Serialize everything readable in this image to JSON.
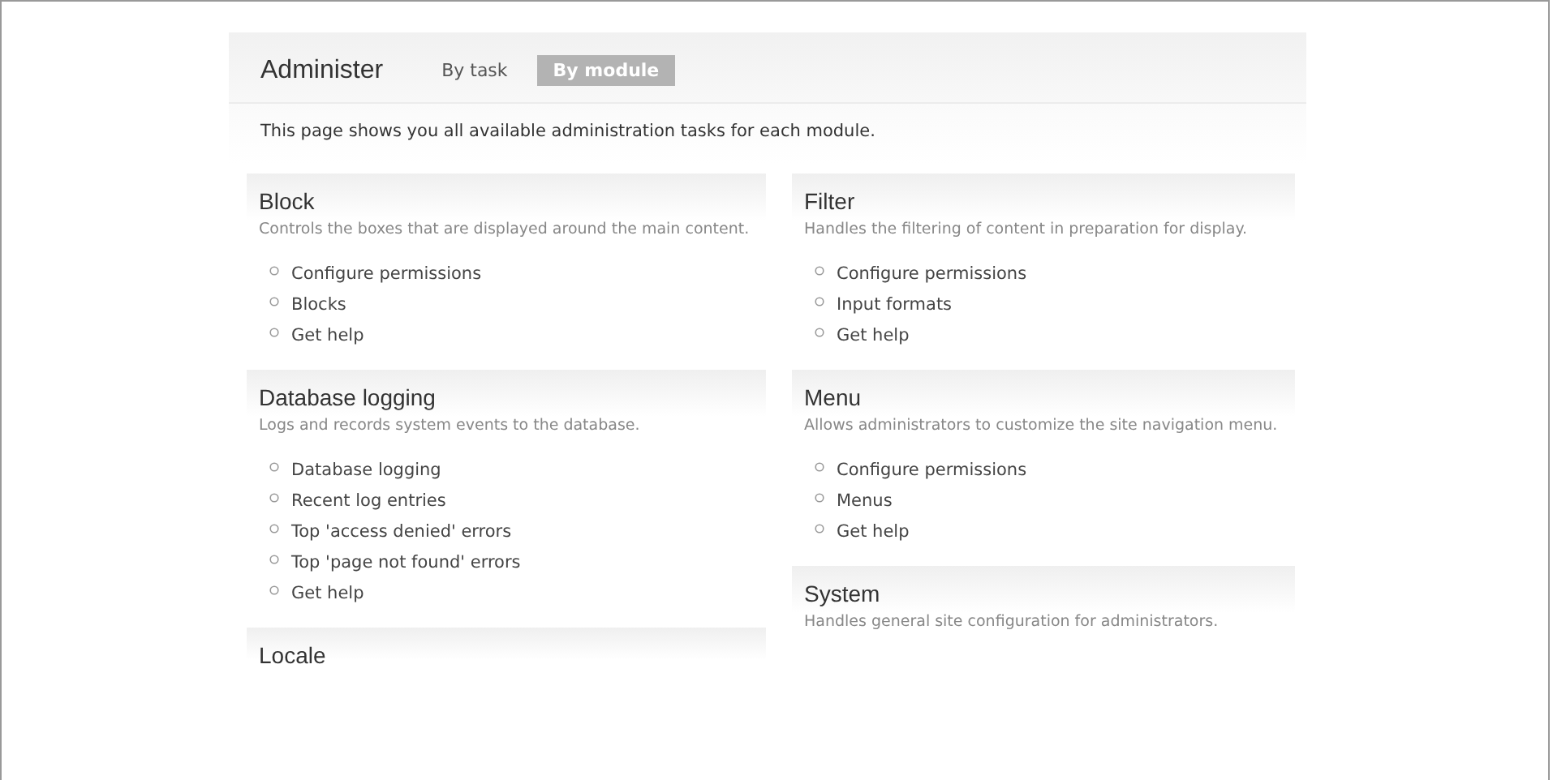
{
  "header": {
    "title": "Administer",
    "tabs": [
      {
        "label": "By task",
        "selected": false
      },
      {
        "label": "By module",
        "selected": true
      }
    ]
  },
  "intro": "This page shows you all available administration tasks for each module.",
  "columns": [
    {
      "modules": [
        {
          "name": "Block",
          "description": "Controls the boxes that are displayed around the main content.",
          "links": [
            "Configure permissions",
            "Blocks",
            "Get help"
          ]
        },
        {
          "name": "Database logging",
          "description": "Logs and records system events to the database.",
          "links": [
            "Database logging",
            "Recent log entries",
            "Top 'access denied' errors",
            "Top 'page not found' errors",
            "Get help"
          ]
        },
        {
          "name": "Locale"
        }
      ]
    },
    {
      "modules": [
        {
          "name": "Filter",
          "description": "Handles the filtering of content in preparation for display.",
          "links": [
            "Configure permissions",
            "Input formats",
            "Get help"
          ]
        },
        {
          "name": "Menu",
          "description": "Allows administrators to customize the site navigation menu.",
          "links": [
            "Configure permissions",
            "Menus",
            "Get help"
          ]
        },
        {
          "name": "System",
          "description": "Handles general site configuration for administrators."
        }
      ]
    }
  ]
}
